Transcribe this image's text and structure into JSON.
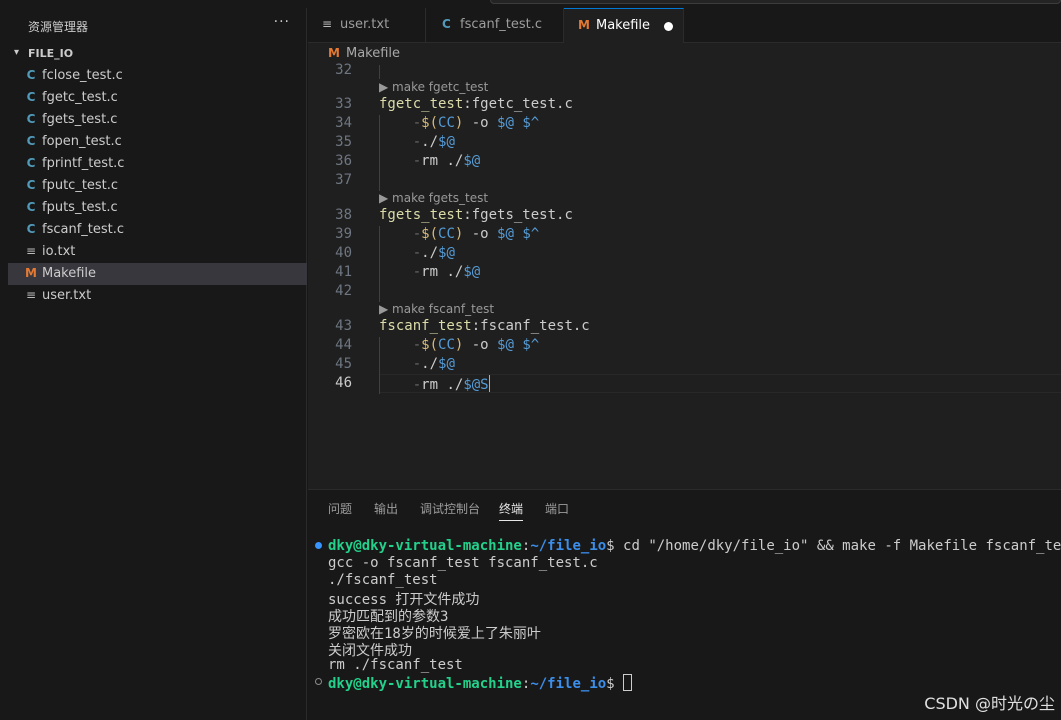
{
  "sidebar": {
    "title": "资源管理器",
    "more": "···",
    "folder": "FILE_IO",
    "files": [
      {
        "name": "fclose_test.c",
        "icon": "C",
        "type": "c"
      },
      {
        "name": "fgetc_test.c",
        "icon": "C",
        "type": "c"
      },
      {
        "name": "fgets_test.c",
        "icon": "C",
        "type": "c"
      },
      {
        "name": "fopen_test.c",
        "icon": "C",
        "type": "c"
      },
      {
        "name": "fprintf_test.c",
        "icon": "C",
        "type": "c"
      },
      {
        "name": "fputc_test.c",
        "icon": "C",
        "type": "c"
      },
      {
        "name": "fputs_test.c",
        "icon": "C",
        "type": "c"
      },
      {
        "name": "fscanf_test.c",
        "icon": "C",
        "type": "c"
      },
      {
        "name": "io.txt",
        "icon": "≡",
        "type": "t"
      },
      {
        "name": "Makefile",
        "icon": "M",
        "type": "m",
        "active": true
      },
      {
        "name": "user.txt",
        "icon": "≡",
        "type": "t"
      }
    ]
  },
  "tabs": [
    {
      "label": "user.txt",
      "icon": "≡"
    },
    {
      "label": "fscanf_test.c",
      "icon": "C"
    },
    {
      "label": "Makefile",
      "icon": "M",
      "active": true
    }
  ],
  "breadcrumb": {
    "icon": "M",
    "label": "Makefile"
  },
  "editor": {
    "line_numbers": [
      "32",
      "33",
      "34",
      "35",
      "36",
      "37",
      "38",
      "39",
      "40",
      "41",
      "42",
      "43",
      "44",
      "45",
      "46"
    ],
    "codelens": [
      "▶ make fgetc_test",
      "▶ make fgets_test",
      "▶ make fscanf_test"
    ],
    "targets": [
      {
        "name": "fgetc_test",
        "dep": "fgetc_test.c"
      },
      {
        "name": "fgets_test",
        "dep": "fgets_test.c"
      },
      {
        "name": "fscanf_test",
        "dep": "fscanf_test.c"
      }
    ],
    "cmd_compile": {
      "pre": "-",
      "dollar": "$",
      "lp": "(",
      "cc": "CC",
      "rp": ")",
      "opt": " -o ",
      "at": "$@",
      "sp": " ",
      "caret": "$^"
    },
    "cmd_run": {
      "pre": "-",
      "path": "./",
      "at": "$@"
    },
    "cmd_rm": {
      "pre": "-",
      "rm": "rm ./",
      "at": "$@"
    },
    "last_rm_suffix": "S",
    "colon": ":"
  },
  "panel": {
    "tabs": [
      "问题",
      "输出",
      "调试控制台",
      "终端",
      "端口"
    ],
    "active_tab": "终端"
  },
  "terminal": {
    "user": "dky@dky-virtual-machine",
    "path": "~/file_io",
    "prompt_sep": ":",
    "dollar": "$",
    "command": " cd \"/home/dky/file_io\" && make -f Makefile fscanf_test",
    "output": [
      "gcc -o fscanf_test fscanf_test.c",
      "./fscanf_test",
      "success 打开文件成功",
      "成功匹配到的参数3",
      "罗密欧在18岁的时候爱上了朱丽叶",
      "关闭文件成功",
      "rm ./fscanf_test"
    ]
  },
  "watermark": "CSDN @时光の尘",
  "colors": {
    "accent": "#0078d4",
    "c_icon": "#519aba",
    "makefile_icon": "#e37933",
    "prompt_user": "#23d18b",
    "prompt_path": "#3b8eea"
  }
}
